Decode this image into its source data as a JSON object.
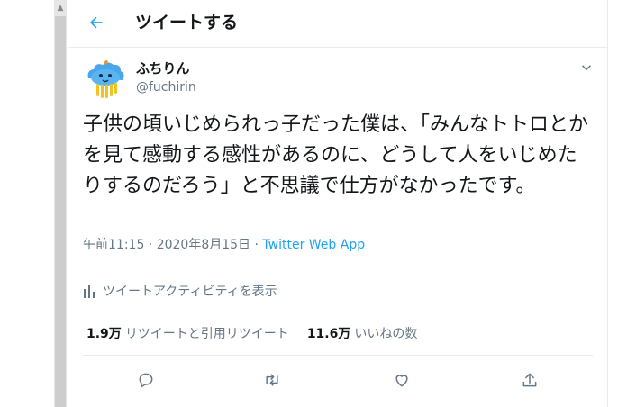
{
  "header": {
    "title": "ツイートする",
    "back_icon": "arrow-left-icon"
  },
  "accent_color": "#1da1f2",
  "tweet": {
    "display_name": "ふちりん",
    "username": "@fuchirin",
    "text": "子供の頃いじめられっ子だった僕は、「みんなトトロとかを見て感動する感性があるのに、どうして人をいじめたりするのだろう」と不思議で仕方がなかったです。",
    "time": "午前11:15 · 2020年8月15日 · ",
    "app": "Twitter Web App",
    "activity_label": "ツイートアクティビティを表示",
    "retweets_count": "1.9万",
    "retweets_label": "リツイートと引用リツイート",
    "likes_count": "11.6万",
    "likes_label": "いいねの数"
  },
  "actions": [
    "reply-icon",
    "retweet-icon",
    "like-icon",
    "share-icon"
  ]
}
